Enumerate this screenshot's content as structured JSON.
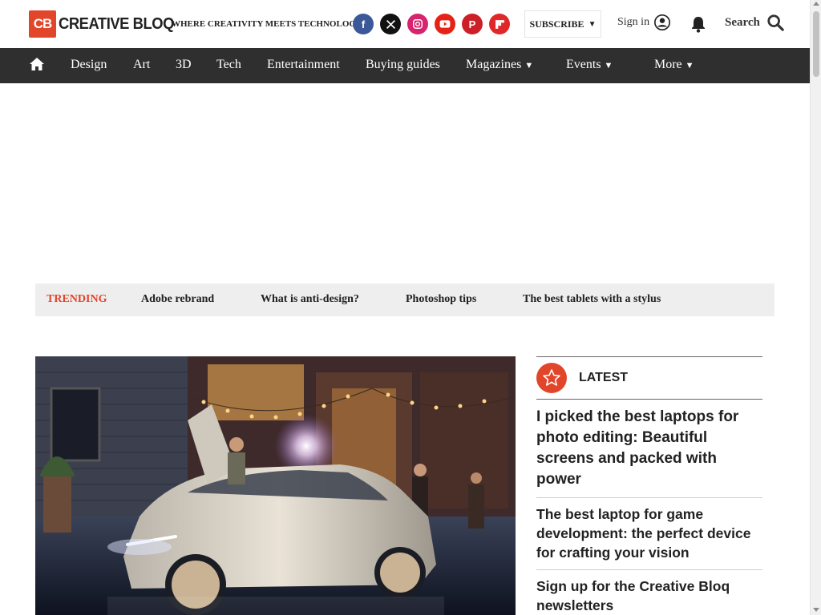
{
  "header": {
    "logo_mark": "CB",
    "logo_text": "CREATIVE BLOQ",
    "tagline": "WHERE CREATIVITY MEETS TECHNOLOGY",
    "socials": [
      {
        "name": "facebook",
        "glyph": "f",
        "color": "#3b5998"
      },
      {
        "name": "x",
        "glyph": "𝕏",
        "color": "#111111"
      },
      {
        "name": "instagram",
        "glyph": "◎",
        "color": "#d6246e"
      },
      {
        "name": "youtube",
        "glyph": "▶",
        "color": "#e62117"
      },
      {
        "name": "pinterest",
        "glyph": "P",
        "color": "#cb2027"
      },
      {
        "name": "flipboard",
        "glyph": "f",
        "color": "#e12828"
      }
    ],
    "subscribe_label": "SUBSCRIBE",
    "signin_label": "Sign in",
    "search_label": "Search"
  },
  "nav": {
    "items": [
      {
        "label": "Design"
      },
      {
        "label": "Art"
      },
      {
        "label": "3D"
      },
      {
        "label": "Tech"
      },
      {
        "label": "Entertainment"
      },
      {
        "label": "Buying guides"
      },
      {
        "label": "Magazines",
        "dropdown": true
      },
      {
        "label": "Events",
        "dropdown": true
      },
      {
        "label": "More",
        "dropdown": true
      }
    ]
  },
  "trending": {
    "label": "TRENDING",
    "links": [
      "Adobe rebrand",
      "What is anti-design?",
      "Photoshop tips",
      "The best tablets with a stylus"
    ]
  },
  "latest": {
    "title": "LATEST",
    "items": [
      "I picked the best laptops for photo editing: Beautiful screens and packed with power",
      "The best laptop for game development: the perfect device for crafting your vision",
      "Sign up for the Creative Bloq newsletters"
    ]
  },
  "colors": {
    "brand": "#e1452a",
    "nav_bg": "#2f2f2f",
    "trending_bg": "#eeeeee"
  }
}
